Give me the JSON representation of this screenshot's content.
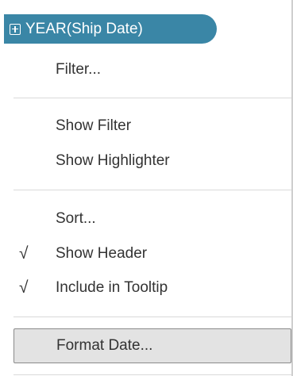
{
  "pill": {
    "label": "YEAR(Ship Date)",
    "icon": "plus-box-icon",
    "color": "#3a86a6"
  },
  "menu": {
    "filter": "Filter...",
    "show_filter": "Show Filter",
    "show_highlighter": "Show Highlighter",
    "sort": "Sort...",
    "show_header": "Show Header",
    "include_in_tooltip": "Include in Tooltip",
    "format_date": "Format Date...",
    "check_mark": "√"
  }
}
